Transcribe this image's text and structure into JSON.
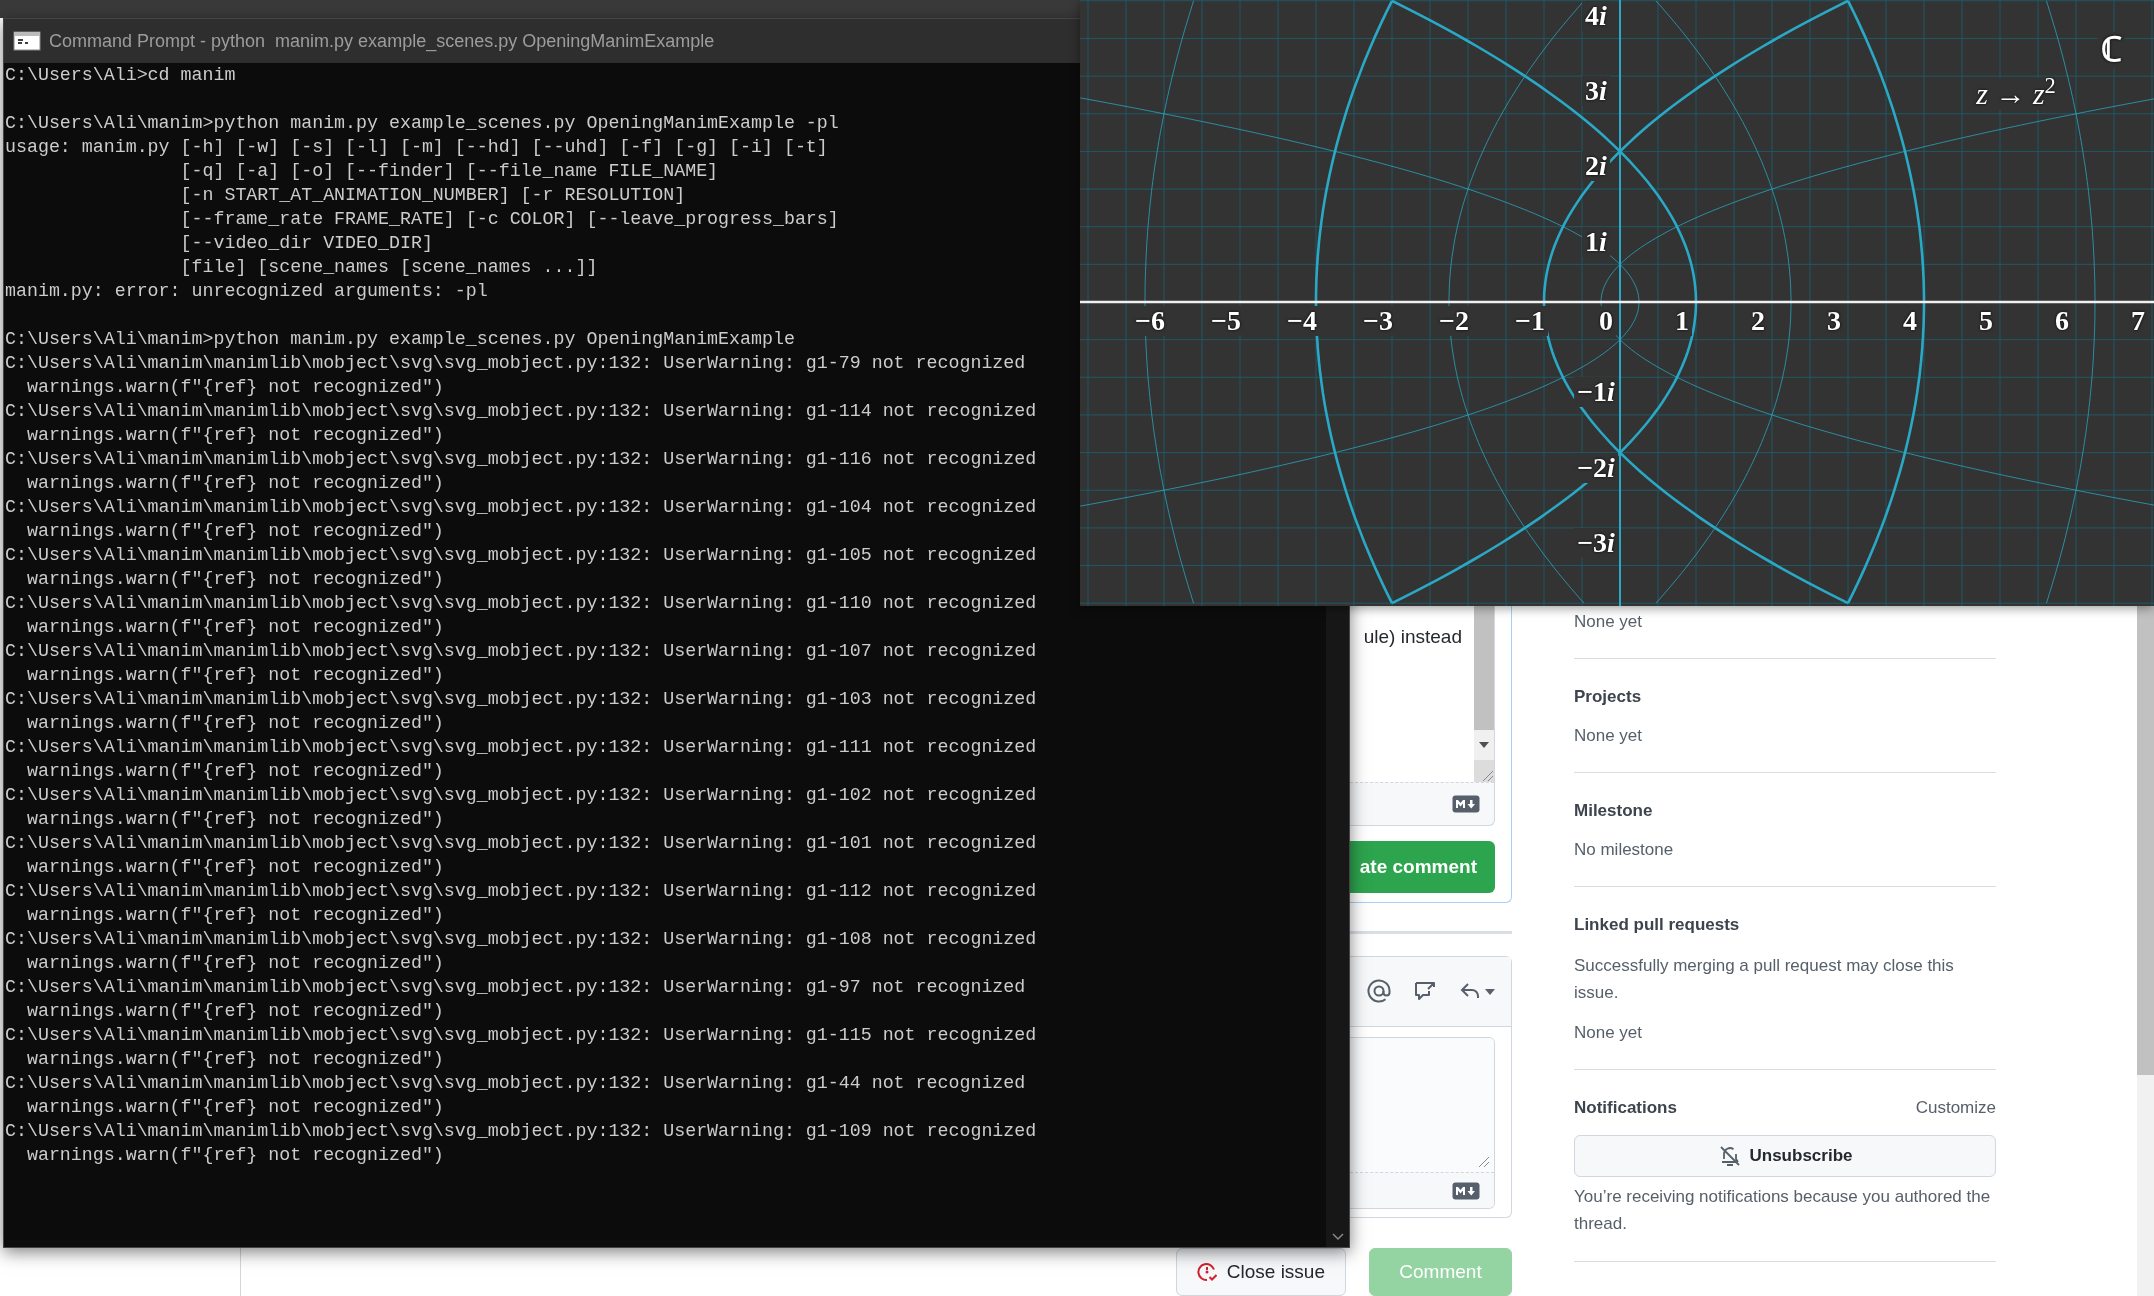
{
  "terminal": {
    "title": "Command Prompt - python  manim.py example_scenes.py OpeningManimExample",
    "blocks": [
      [
        "C:\\Users\\Ali>cd manim"
      ],
      [
        "C:\\Users\\Ali\\manim>python manim.py example_scenes.py OpeningManimExample -pl",
        "usage: manim.py [-h] [-w] [-s] [-l] [-m] [--hd] [--uhd] [-f] [-g] [-i] [-t]",
        "                [-q] [-a] [-o] [--finder] [--file_name FILE_NAME]",
        "                [-n START_AT_ANIMATION_NUMBER] [-r RESOLUTION]",
        "                [--frame_rate FRAME_RATE] [-c COLOR] [--leave_progress_bars]",
        "                [--video_dir VIDEO_DIR]",
        "                [file] [scene_names [scene_names ...]]",
        "manim.py: error: unrecognized arguments: -pl"
      ],
      [
        "C:\\Users\\Ali\\manim>python manim.py example_scenes.py OpeningManimExample",
        "C:\\Users\\Ali\\manim\\manimlib\\mobject\\svg\\svg_mobject.py:132: UserWarning: g1-79 not recognized",
        "  warnings.warn(f\"{ref} not recognized\")",
        "C:\\Users\\Ali\\manim\\manimlib\\mobject\\svg\\svg_mobject.py:132: UserWarning: g1-114 not recognized",
        "  warnings.warn(f\"{ref} not recognized\")",
        "C:\\Users\\Ali\\manim\\manimlib\\mobject\\svg\\svg_mobject.py:132: UserWarning: g1-116 not recognized",
        "  warnings.warn(f\"{ref} not recognized\")",
        "C:\\Users\\Ali\\manim\\manimlib\\mobject\\svg\\svg_mobject.py:132: UserWarning: g1-104 not recognized",
        "  warnings.warn(f\"{ref} not recognized\")",
        "C:\\Users\\Ali\\manim\\manimlib\\mobject\\svg\\svg_mobject.py:132: UserWarning: g1-105 not recognized",
        "  warnings.warn(f\"{ref} not recognized\")",
        "C:\\Users\\Ali\\manim\\manimlib\\mobject\\svg\\svg_mobject.py:132: UserWarning: g1-110 not recognized",
        "  warnings.warn(f\"{ref} not recognized\")",
        "C:\\Users\\Ali\\manim\\manimlib\\mobject\\svg\\svg_mobject.py:132: UserWarning: g1-107 not recognized",
        "  warnings.warn(f\"{ref} not recognized\")",
        "C:\\Users\\Ali\\manim\\manimlib\\mobject\\svg\\svg_mobject.py:132: UserWarning: g1-103 not recognized",
        "  warnings.warn(f\"{ref} not recognized\")",
        "C:\\Users\\Ali\\manim\\manimlib\\mobject\\svg\\svg_mobject.py:132: UserWarning: g1-111 not recognized",
        "  warnings.warn(f\"{ref} not recognized\")",
        "C:\\Users\\Ali\\manim\\manimlib\\mobject\\svg\\svg_mobject.py:132: UserWarning: g1-102 not recognized",
        "  warnings.warn(f\"{ref} not recognized\")",
        "C:\\Users\\Ali\\manim\\manimlib\\mobject\\svg\\svg_mobject.py:132: UserWarning: g1-101 not recognized",
        "  warnings.warn(f\"{ref} not recognized\")",
        "C:\\Users\\Ali\\manim\\manimlib\\mobject\\svg\\svg_mobject.py:132: UserWarning: g1-112 not recognized",
        "  warnings.warn(f\"{ref} not recognized\")",
        "C:\\Users\\Ali\\manim\\manimlib\\mobject\\svg\\svg_mobject.py:132: UserWarning: g1-108 not recognized",
        "  warnings.warn(f\"{ref} not recognized\")",
        "C:\\Users\\Ali\\manim\\manimlib\\mobject\\svg\\svg_mobject.py:132: UserWarning: g1-97 not recognized",
        "  warnings.warn(f\"{ref} not recognized\")",
        "C:\\Users\\Ali\\manim\\manimlib\\mobject\\svg\\svg_mobject.py:132: UserWarning: g1-115 not recognized",
        "  warnings.warn(f\"{ref} not recognized\")",
        "C:\\Users\\Ali\\manim\\manimlib\\mobject\\svg\\svg_mobject.py:132: UserWarning: g1-44 not recognized",
        "  warnings.warn(f\"{ref} not recognized\")",
        "C:\\Users\\Ali\\manim\\manimlib\\mobject\\svg\\svg_mobject.py:132: UserWarning: g1-109 not recognized",
        "  warnings.warn(f\"{ref} not recognized\")"
      ]
    ]
  },
  "plot_window": {
    "x_labels": [
      "−6",
      "−5",
      "−4",
      "−3",
      "−2",
      "−1",
      "0",
      "1",
      "2",
      "3",
      "4",
      "5",
      "6",
      "7"
    ],
    "y_labels": [
      {
        "number": "4",
        "unit": "i"
      },
      {
        "number": "3",
        "unit": "i"
      },
      {
        "number": "2",
        "unit": "i"
      },
      {
        "number": "1",
        "unit": "i"
      },
      {
        "number": "−1",
        "unit": "i"
      },
      {
        "number": "−2",
        "unit": "i"
      },
      {
        "number": "−3",
        "unit": "i"
      }
    ],
    "set_symbol": "ℂ",
    "mapping": "*z* → *z*$^{2}$"
  },
  "issue": {
    "edit_comment": {
      "text_fragment": "ule) instead",
      "update_button": "ate comment"
    },
    "actions": [
      {
        "label": "Close issue",
        "kind": "close",
        "disabled": false
      },
      {
        "label": "Comment",
        "kind": "submit",
        "disabled": true
      }
    ]
  },
  "sidebar": {
    "sections": [
      {
        "values": [
          "None yet"
        ]
      },
      {
        "heading": "Projects",
        "values": [
          "None yet"
        ]
      },
      {
        "heading": "Milestone",
        "values": [
          "No milestone"
        ]
      },
      {
        "heading": "Linked pull requests",
        "note": "Successfully merging a pull request may close this issue.",
        "values": [
          "None yet"
        ]
      },
      {
        "heading": "Notifications",
        "action": "Customize",
        "button": "Unsubscribe",
        "note": "You’re receiving notifications because you authored the thread."
      }
    ]
  }
}
